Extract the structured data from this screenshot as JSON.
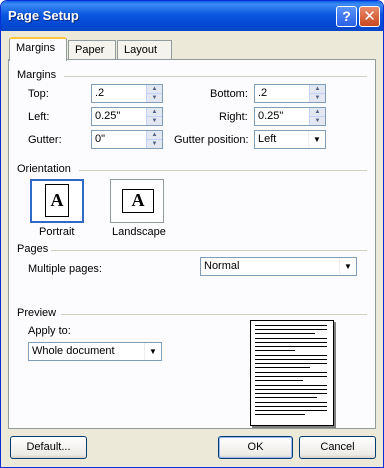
{
  "window": {
    "title": "Page Setup"
  },
  "titlebar": {
    "help_label": "?",
    "close_label": "✕"
  },
  "tabs": [
    {
      "label": "Margins",
      "active": true
    },
    {
      "label": "Paper",
      "active": false
    },
    {
      "label": "Layout",
      "active": false
    }
  ],
  "margins": {
    "group_label": "Margins",
    "top": {
      "label": "Top:",
      "value": ".2"
    },
    "bottom": {
      "label": "Bottom:",
      "value": ".2"
    },
    "left": {
      "label": "Left:",
      "value": "0.25\""
    },
    "right": {
      "label": "Right:",
      "value": "0.25\""
    },
    "gutter": {
      "label": "Gutter:",
      "value": "0\""
    },
    "gutter_position": {
      "label": "Gutter position:",
      "value": "Left"
    }
  },
  "orientation": {
    "group_label": "Orientation",
    "portrait_label": "Portrait",
    "landscape_label": "Landscape",
    "glyph": "A",
    "selected": "portrait"
  },
  "pages": {
    "group_label": "Pages",
    "multiple_pages_label": "Multiple pages:",
    "multiple_pages_value": "Normal"
  },
  "preview": {
    "group_label": "Preview",
    "apply_to_label": "Apply to:",
    "apply_to_value": "Whole document"
  },
  "buttons": {
    "default_label": "Default...",
    "ok_label": "OK",
    "cancel_label": "Cancel"
  },
  "colors": {
    "title_bar": "#0a58e0",
    "dialog_face": "#ece9d8",
    "selection_border": "#316ac5",
    "active_tab_accent": "#ffc83c"
  }
}
